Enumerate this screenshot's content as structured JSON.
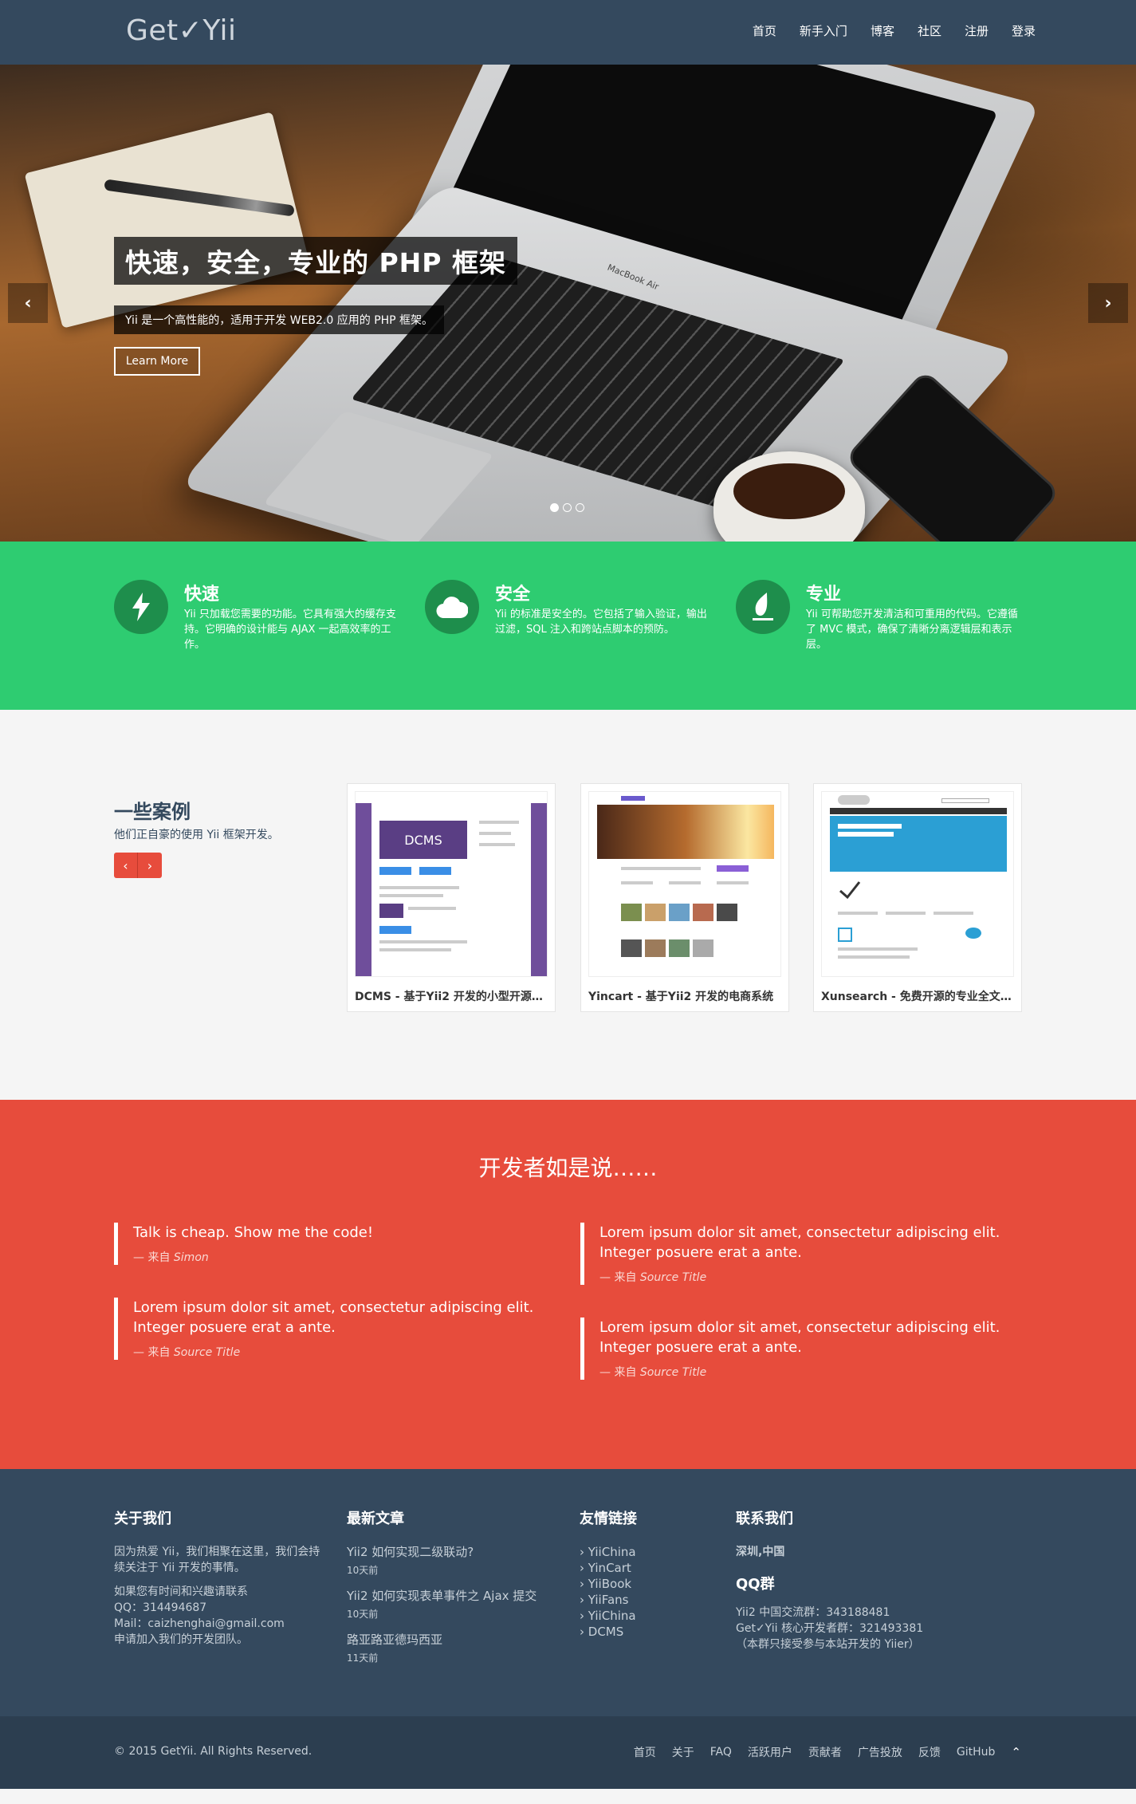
{
  "nav": {
    "brand": "Get✓Yii",
    "links": [
      "首页",
      "新手入门",
      "博客",
      "社区",
      "注册",
      "登录"
    ]
  },
  "hero": {
    "title": "快速，安全，专业的 PHP 框架",
    "subtitle": "Yii 是一个高性能的，适用于开发 WEB2.0 应用的 PHP 框架。",
    "button": "Learn More",
    "laptop_text": "MacBook Air",
    "left_arrow": "‹",
    "right_arrow": "›",
    "slide_count": 3,
    "active_slide": 1
  },
  "features": [
    {
      "title": "快速",
      "icon": "bolt-icon",
      "text": "Yii 只加载您需要的功能。它具有强大的缓存支持。它明确的设计能与 AJAX 一起高效率的工作。"
    },
    {
      "title": "安全",
      "icon": "cloud-icon",
      "text": "Yii 的标准是安全的。它包括了输入验证，输出过滤，SQL 注入和跨站点脚本的预防。"
    },
    {
      "title": "专业",
      "icon": "leaf-icon",
      "text": "Yii 可帮助您开发清洁和可重用的代码。它遵循了 MVC 模式，确保了清晰分离逻辑层和表示层。"
    }
  ],
  "cases": {
    "title": "一些案例",
    "subtitle": "他们正自豪的使用 Yii 框架开发。",
    "prev": "‹",
    "next": "›",
    "items": [
      {
        "caption": "DCMS - 基于Yii2 开发的小型开源…",
        "thumb_label": "DCMS"
      },
      {
        "caption": "Yincart - 基于Yii2 开发的电商系统"
      },
      {
        "caption": "Xunsearch - 免费开源的专业全文…"
      }
    ]
  },
  "testimonials": {
    "title": "开发者如是说……",
    "from": "— 来自",
    "quotes": [
      {
        "text": "Talk is cheap. Show me the code!",
        "source": "Simon"
      },
      {
        "text": "Lorem ipsum dolor sit amet, consectetur adipiscing elit. Integer posuere erat a ante.",
        "source": "Source Title"
      },
      {
        "text": "Lorem ipsum dolor sit amet, consectetur adipiscing elit. Integer posuere erat a ante.",
        "source": "Source Title"
      },
      {
        "text": "Lorem ipsum dolor sit amet, consectetur adipiscing elit. Integer posuere erat a ante.",
        "source": "Source Title"
      }
    ]
  },
  "footer": {
    "about": {
      "title": "关于我们",
      "p1": "因为热爱 Yii，我们相聚在这里，我们会持续关注于 Yii 开发的事情。",
      "p2": "如果您有时间和兴趣请联系",
      "qq": "QQ：314494687",
      "mail": "Mail：caizhenghai@gmail.com",
      "join": "申请加入我们的开发团队。"
    },
    "articles": {
      "title": "最新文章",
      "items": [
        {
          "title": "Yii2 如何实现二级联动?",
          "date": "10天前"
        },
        {
          "title": "Yii2 如何实现表单事件之 Ajax 提交",
          "date": "10天前"
        },
        {
          "title": "路亚路亚德玛西亚",
          "date": "11天前"
        }
      ]
    },
    "links": {
      "title": "友情链接",
      "items": [
        "› YiiChina",
        "› YinCart",
        "› YiiBook",
        "› YiiFans",
        "› YiiChina",
        "› DCMS"
      ]
    },
    "contact": {
      "title": "联系我们",
      "city": "深圳,中国",
      "qq_title": "QQ群",
      "group1": "Yii2 中国交流群：343188481",
      "group2": "Get✓Yii 核心开发者群：321493381（本群只接受参与本站开发的 Yiier）"
    }
  },
  "bottom": {
    "copyright": "© 2015 GetYii. All Rights Reserved.",
    "links": [
      "首页",
      "关于",
      "FAQ",
      "活跃用户",
      "贡献者",
      "广告投放",
      "反馈",
      "GitHub"
    ],
    "totop": "⌃"
  },
  "colors": {
    "nav": "#34495e",
    "features": "#2ecc71",
    "testimonials": "#e74c3c",
    "footer": "#34495e",
    "bottom": "#2c3e50"
  }
}
